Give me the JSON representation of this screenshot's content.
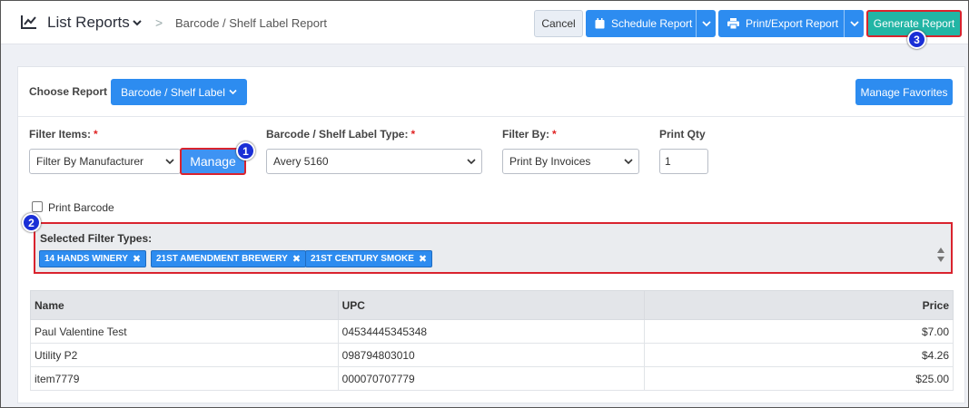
{
  "header": {
    "title": "List Reports",
    "breadcrumb_sep": ">",
    "breadcrumb": "Barcode / Shelf Label Report",
    "cancel_label": "Cancel",
    "schedule_label": "Schedule Report",
    "print_export_label": "Print/Export Report",
    "generate_label": "Generate Report"
  },
  "report": {
    "choose_label": "Choose Report",
    "choose_value": "Barcode / Shelf Label",
    "manage_favorites_label": "Manage Favorites"
  },
  "filters": {
    "filter_items_label": "Filter Items:",
    "filter_items_value": "Filter By Manufacturer",
    "manage_label": "Manage",
    "label_type_label": "Barcode / Shelf Label Type:",
    "label_type_value": "Avery 5160",
    "filter_by_label": "Filter By:",
    "filter_by_value": "Print By Invoices",
    "print_qty_label": "Print Qty",
    "print_qty_value": "1",
    "required_mark": "*",
    "print_barcode_label": "Print Barcode",
    "print_barcode_checked": false
  },
  "selected_filters": {
    "title": "Selected Filter Types:",
    "tags": [
      "14 HANDS WINERY",
      "21ST AMENDMENT BREWERY",
      "21ST CENTURY SMOKE"
    ],
    "remove_glyph": "✖"
  },
  "table": {
    "columns": [
      "Name",
      "UPC",
      "Price"
    ],
    "rows": [
      [
        "Paul Valentine Test",
        "04534445345348",
        "$7.00"
      ],
      [
        "Utility P2",
        "098794803010",
        "$4.26"
      ],
      [
        "item7779",
        "000070707779",
        "$25.00"
      ]
    ]
  },
  "annotations": [
    "1",
    "2",
    "3"
  ],
  "colors": {
    "primary": "#2d8cf0",
    "generate": "#22b5a5",
    "highlight": "#d9232e",
    "badge": "#1a2fd6"
  }
}
